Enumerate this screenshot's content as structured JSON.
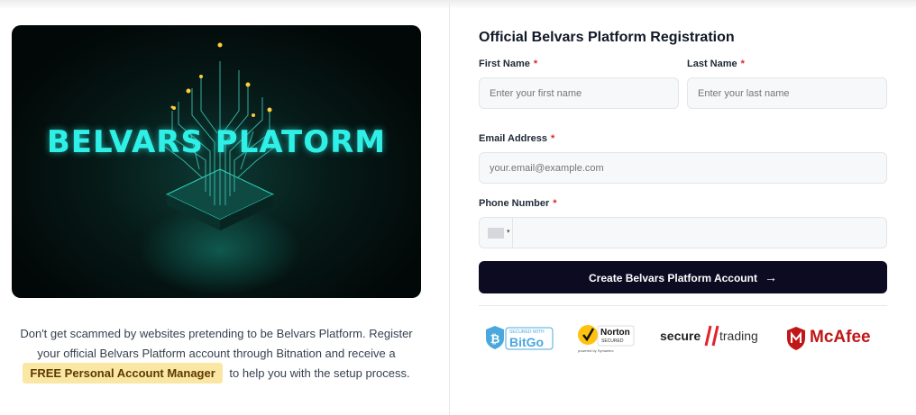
{
  "promo": {
    "hero_title": "BELVARS PLATORM",
    "lead_text": "Don't get scammed by websites pretending to be Belvars Platform. Register your official Belvars Platform account through Bitnation and receive a",
    "badge_text": "FREE Personal Account Manager",
    "tail_text": "to help you with the setup process."
  },
  "form": {
    "title": "Official Belvars Platform Registration",
    "required_mark": "*",
    "first_name": {
      "label": "First Name",
      "placeholder": "Enter your first name"
    },
    "last_name": {
      "label": "Last Name",
      "placeholder": "Enter your last name"
    },
    "email": {
      "label": "Email Address",
      "placeholder": "your.email@example.com"
    },
    "phone": {
      "label": "Phone Number",
      "value": ""
    },
    "submit_label": "Create Belvars Platform Account",
    "submit_icon": "arrow-right-icon"
  },
  "trust_badges": {
    "bitgo": {
      "small": "SECURED WITH",
      "name": "BitGo"
    },
    "norton": {
      "name": "Norton",
      "sub": "SECURED",
      "powered": "powered by Symantec"
    },
    "secure_trading": {
      "left": "secure",
      "right": "trading"
    },
    "mcafee": {
      "name": "McAfee"
    }
  },
  "colors": {
    "accent_dark": "#0c0b22",
    "required": "#dc2626",
    "badge_bg": "#fbe7a4",
    "hero_text": "#2ff0e6"
  }
}
